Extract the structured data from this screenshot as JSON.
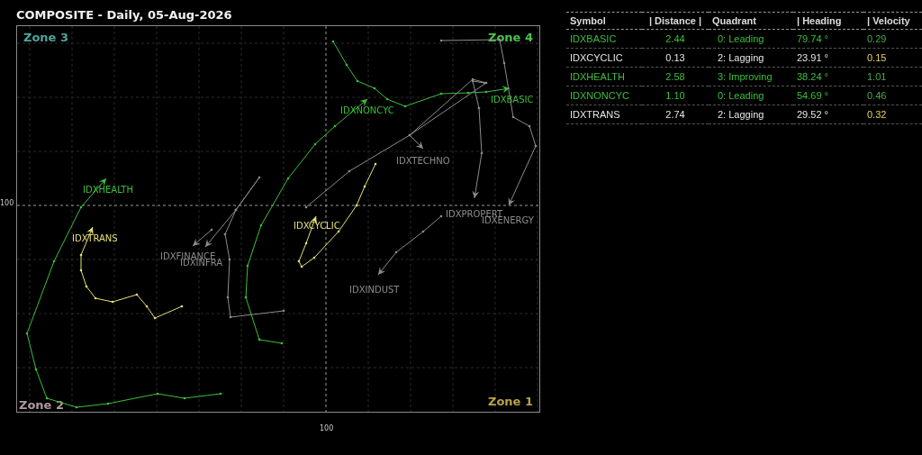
{
  "title": "COMPOSITE - Daily, 05-Aug-2026",
  "chart": {
    "zones": [
      {
        "label": "Zone 3",
        "color": "#4fa6a0"
      },
      {
        "label": "Zone 4",
        "color": "#4cc24c"
      },
      {
        "label": "Zone 2",
        "color": "#b09a9c"
      },
      {
        "label": "Zone 1",
        "color": "#b8a24a"
      }
    ],
    "x_tick": "100",
    "y_tick": "100",
    "trails": [
      {
        "label": "IDXHEALTH",
        "color": "#3cbf3c"
      },
      {
        "label": "IDXTRANS",
        "color": "#e8e07a"
      },
      {
        "label": "IDXFINANCE",
        "color": "#8c8c8c"
      },
      {
        "label": "IDXINFRA",
        "color": "#8c8c8c"
      },
      {
        "label": "IDXNONCYC",
        "color": "#3cbf3c"
      },
      {
        "label": "IDXBASIC",
        "color": "#3cbf3c"
      },
      {
        "label": "IDXTECHNO",
        "color": "#8c8c8c"
      },
      {
        "label": "IDXPROPERT",
        "color": "#8c8c8c"
      },
      {
        "label": "IDXENERGY",
        "color": "#8c8c8c"
      },
      {
        "label": "IDXINDUST",
        "color": "#8c8c8c"
      },
      {
        "label": "IDXCYCLIC",
        "color": "#e8e07a"
      }
    ]
  },
  "table": {
    "columns": [
      "Symbol",
      "| Distance |",
      "Quadrant",
      "| Heading",
      "| Velocity"
    ],
    "rows": [
      {
        "symbol": "IDXBASIC",
        "distance": "2.44",
        "quadrant": "0: Leading",
        "heading": "79.74 °",
        "color": "#3cbf3c",
        "velocity": {
          "text": "0.29",
          "color": "#4aa84a"
        }
      },
      {
        "symbol": "IDXCYCLIC",
        "distance": "0.13",
        "quadrant": "2: Lagging",
        "heading": "23.91 °",
        "color": "#e6e6e6",
        "velocity": {
          "text": "0.15",
          "color": "#e8d060"
        }
      },
      {
        "symbol": "IDXHEALTH",
        "distance": "2.58",
        "quadrant": "3: Improving",
        "heading": "38.24 °",
        "color": "#3cbf3c",
        "velocity": {
          "text": "1.01",
          "color": "#4aa84a"
        }
      },
      {
        "symbol": "IDXNONCYC",
        "distance": "1.10",
        "quadrant": "0: Leading",
        "heading": "54.69 °",
        "color": "#3cbf3c",
        "velocity": {
          "text": "0.46",
          "color": "#4aa84a"
        }
      },
      {
        "symbol": "IDXTRANS",
        "distance": "2.74",
        "quadrant": "2: Lagging",
        "heading": "29.52 °",
        "color": "#e6e6e6",
        "velocity": {
          "text": "0.32",
          "color": "#e8d060"
        }
      }
    ]
  }
}
